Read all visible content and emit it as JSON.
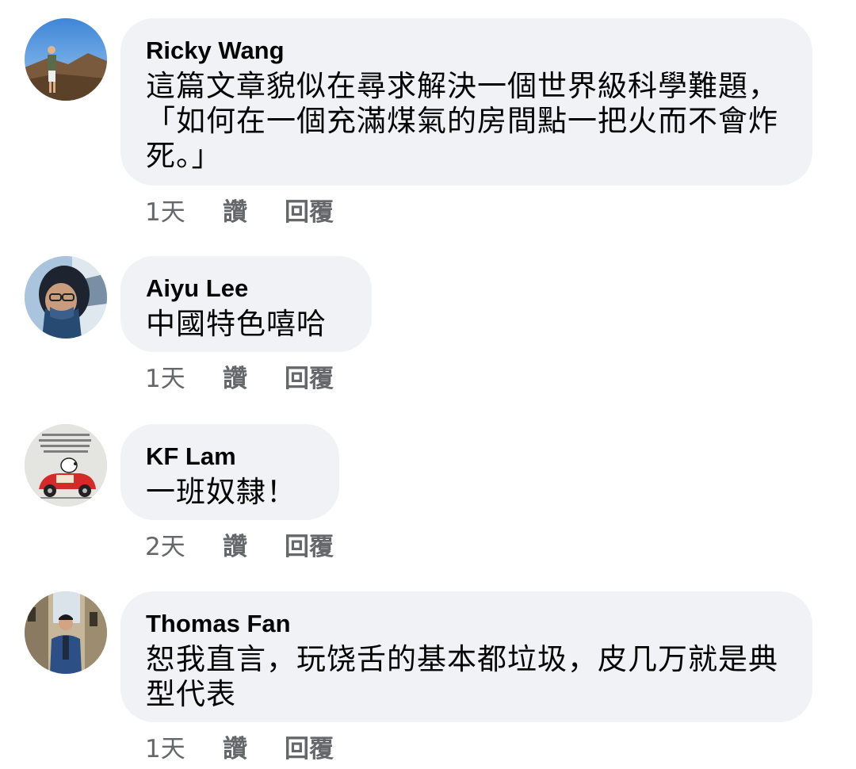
{
  "comments": [
    {
      "author": "Ricky Wang",
      "text": "這篇文章貌似在尋求解決一個世界級科學難題，「如何在一個充滿煤氣的房間點一把火而不會炸死。」",
      "time": "1天",
      "like_label": "讚",
      "reply_label": "回覆"
    },
    {
      "author": "Aiyu Lee",
      "text": "中國特色嘻哈",
      "time": "1天",
      "like_label": "讚",
      "reply_label": "回覆"
    },
    {
      "author": "KF Lam",
      "text": "一班奴隸！",
      "time": "2天",
      "like_label": "讚",
      "reply_label": "回覆"
    },
    {
      "author": "Thomas Fan",
      "text": "恕我直言，玩饶舌的基本都垃圾，皮几万就是典型代表",
      "time": "1天",
      "like_label": "讚",
      "reply_label": "回覆"
    }
  ],
  "colors": {
    "bubble_bg": "#f0f2f5",
    "text": "#050505",
    "meta": "#65676b"
  }
}
